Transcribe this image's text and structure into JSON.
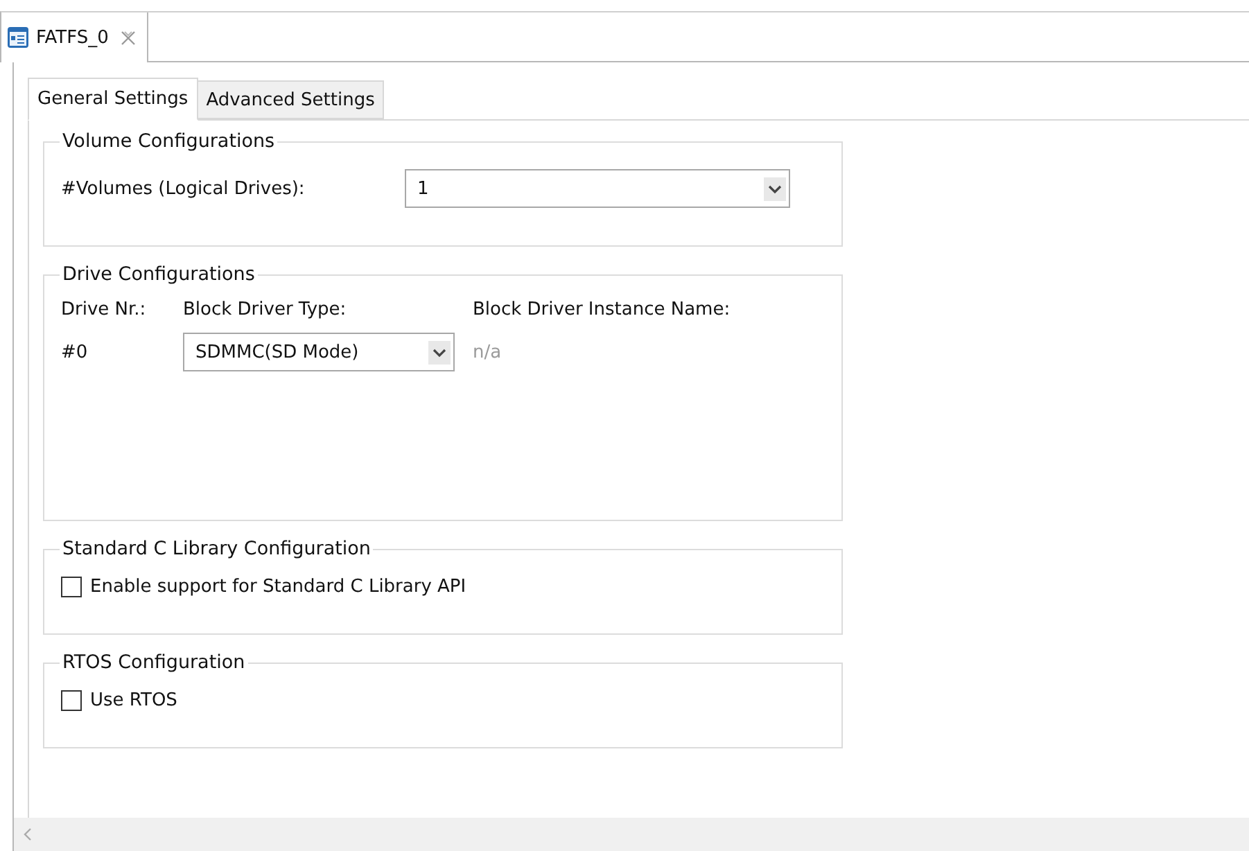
{
  "editor_tab": {
    "title": "FATFS_0"
  },
  "tabs": [
    {
      "label": "General Settings",
      "selected": true
    },
    {
      "label": "Advanced Settings",
      "selected": false
    }
  ],
  "groups": [
    {
      "kind": "select",
      "title": "Volume Configurations",
      "label": "#Volumes (Logical Drives):",
      "value": "1"
    },
    {
      "kind": "drives",
      "title": "Drive Configurations",
      "columns": [
        "Drive Nr.:",
        "Block Driver Type:",
        "Block Driver Instance Name:"
      ],
      "rows": [
        {
          "drive": "#0",
          "type": "SDMMC(SD Mode)",
          "instance": "n/a",
          "instance_disabled": true
        }
      ]
    },
    {
      "kind": "checkbox",
      "title": "Standard C Library Configuration",
      "label": "Enable support for Standard C Library API",
      "checked": false
    },
    {
      "kind": "checkbox",
      "title": "RTOS Configuration",
      "label": "Use RTOS",
      "checked": false
    }
  ]
}
